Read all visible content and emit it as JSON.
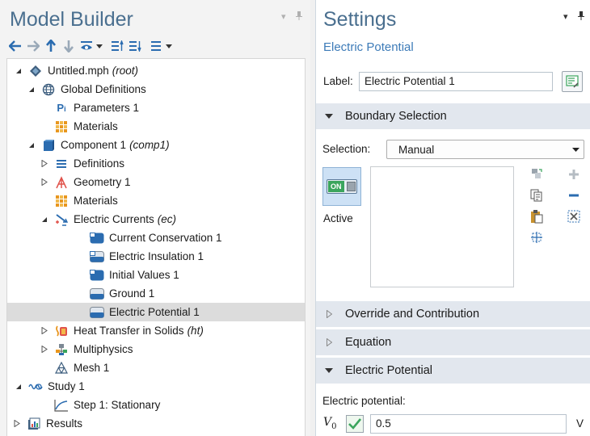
{
  "model_builder": {
    "title": "Model Builder",
    "tree": [
      {
        "label": "Untitled.mph",
        "tag": "(root)"
      },
      {
        "label": "Global Definitions",
        "tag": ""
      },
      {
        "label": "Parameters 1",
        "tag": ""
      },
      {
        "label": "Materials",
        "tag": ""
      },
      {
        "label": "Component 1",
        "tag": "(comp1)"
      },
      {
        "label": "Definitions",
        "tag": ""
      },
      {
        "label": "Geometry 1",
        "tag": ""
      },
      {
        "label": "Materials",
        "tag": ""
      },
      {
        "label": "Electric Currents",
        "tag": "(ec)"
      },
      {
        "label": "Current Conservation 1",
        "tag": ""
      },
      {
        "label": "Electric Insulation 1",
        "tag": ""
      },
      {
        "label": "Initial Values 1",
        "tag": ""
      },
      {
        "label": "Ground 1",
        "tag": ""
      },
      {
        "label": "Electric Potential 1",
        "tag": ""
      },
      {
        "label": "Heat Transfer in Solids",
        "tag": "(ht)"
      },
      {
        "label": "Multiphysics",
        "tag": ""
      },
      {
        "label": "Mesh 1",
        "tag": ""
      },
      {
        "label": "Study 1",
        "tag": ""
      },
      {
        "label": "Step 1: Stationary",
        "tag": ""
      },
      {
        "label": "Results",
        "tag": ""
      }
    ]
  },
  "settings": {
    "title": "Settings",
    "subtitle": "Electric Potential",
    "label_caption": "Label:",
    "label_value": "Electric Potential 1",
    "boundary_selection": {
      "header": "Boundary Selection",
      "selection_caption": "Selection:",
      "selection_value": "Manual",
      "active_label": "Active",
      "toggle_text": "ON"
    },
    "override_header": "Override and Contribution",
    "equation_header": "Equation",
    "electric_potential": {
      "header": "Electric Potential",
      "caption": "Electric potential:",
      "symbol": "V",
      "subscript": "0",
      "value": "0.5",
      "unit": "V"
    }
  },
  "colors": {
    "title": "#4a6f8f",
    "subtitle": "#3d7bb8",
    "section_bg": "#e2e7ee",
    "selected_row": "#dcdcdc",
    "toolbar_blue": "#2b6cb0"
  }
}
